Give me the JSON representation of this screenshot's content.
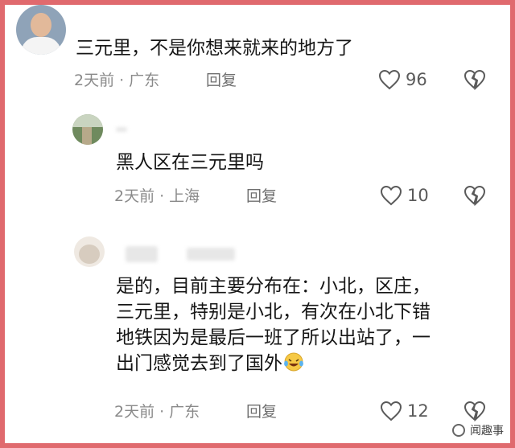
{
  "comments": [
    {
      "text": "三元里，不是你想来就来的地方了",
      "time": "2天前",
      "location": "广东",
      "reply_label": "回复",
      "likes": "96"
    },
    {
      "text": "黑人区在三元里吗",
      "time": "2天前",
      "location": "上海",
      "reply_label": "回复",
      "likes": "10"
    },
    {
      "text_lines": [
        "是的，目前主要分布在：小北，区庄，",
        "三元里，特别是小北，有次在小北下错",
        "地铁因为是最后一班了所以出站了，一",
        "出门感觉去到了国外"
      ],
      "time": "2天前",
      "location": "广东",
      "reply_label": "回复",
      "likes": "12"
    }
  ],
  "separator": "·",
  "watermark": "闻趣事",
  "colors": {
    "frame": "#e06a6e",
    "text": "#161616",
    "meta": "#8a8a8a"
  }
}
